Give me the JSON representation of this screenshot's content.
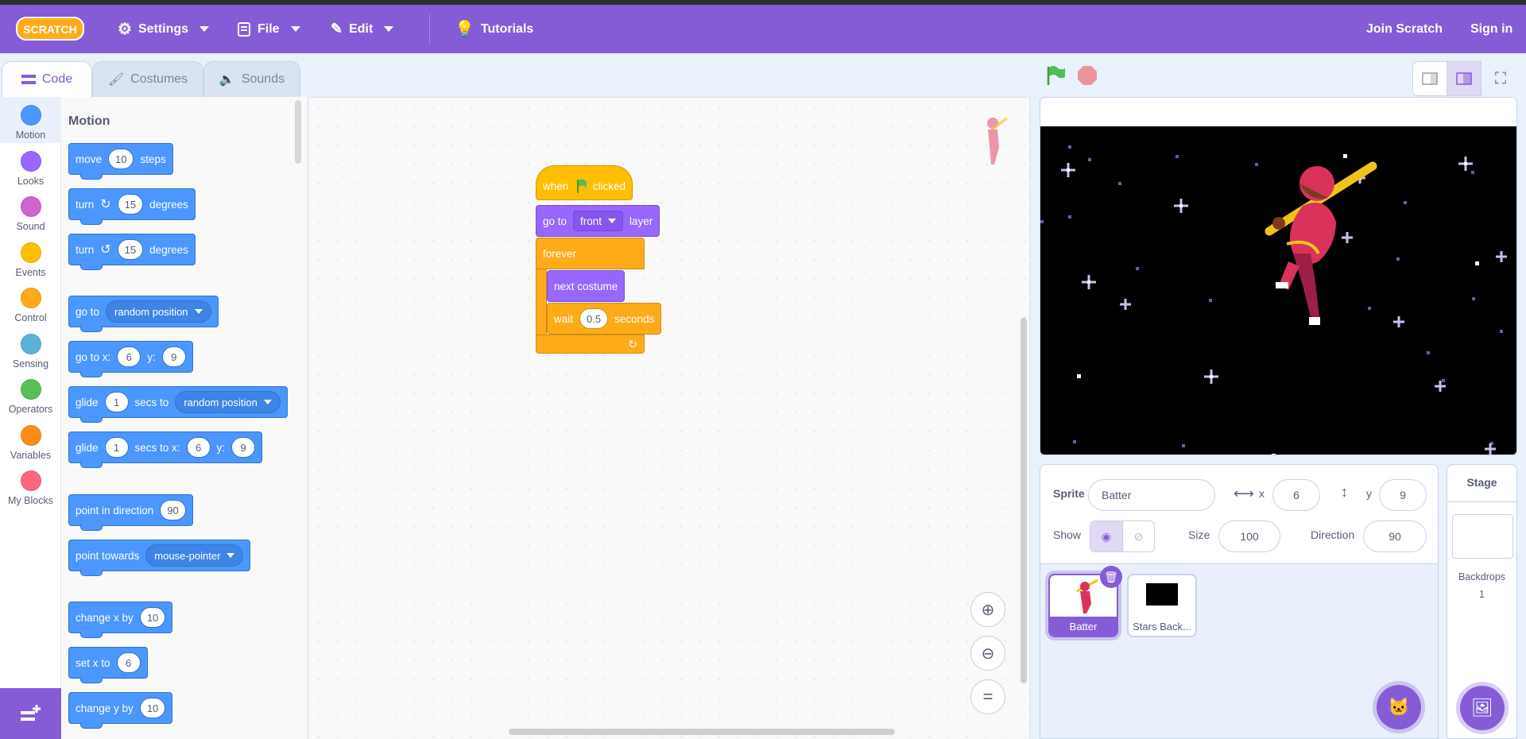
{
  "menubar": {
    "logo_text": "SCRATCH",
    "settings": "Settings",
    "file": "File",
    "edit": "Edit",
    "tutorials": "Tutorials",
    "join": "Join Scratch",
    "signin": "Sign in"
  },
  "tabs": {
    "code": "Code",
    "costumes": "Costumes",
    "sounds": "Sounds"
  },
  "categories": [
    "Motion",
    "Looks",
    "Sound",
    "Events",
    "Control",
    "Sensing",
    "Operators",
    "Variables",
    "My Blocks"
  ],
  "category_colors": [
    "#4c97ff",
    "#9966ff",
    "#cf63cf",
    "#ffbf00",
    "#ffab19",
    "#5cb1d6",
    "#59c059",
    "#ff8c1a",
    "#ff6680"
  ],
  "palette": {
    "title": "Motion",
    "move": {
      "a": "move",
      "n": "10",
      "b": "steps"
    },
    "turn_cw": {
      "a": "turn",
      "n": "15",
      "b": "degrees"
    },
    "turn_ccw": {
      "a": "turn",
      "n": "15",
      "b": "degrees"
    },
    "goto": {
      "a": "go to",
      "d": "random position"
    },
    "gotoxy": {
      "a": "go to x:",
      "x": "6",
      "ylab": "y:",
      "y": "9"
    },
    "glide1": {
      "a": "glide",
      "n": "1",
      "b": "secs to",
      "d": "random position"
    },
    "glide2": {
      "a": "glide",
      "n": "1",
      "b": "secs to x:",
      "x": "6",
      "ylab": "y:",
      "y": "9"
    },
    "point_dir": {
      "a": "point in direction",
      "n": "90"
    },
    "point_tow": {
      "a": "point towards",
      "d": "mouse-pointer"
    },
    "change_x": {
      "a": "change x by",
      "n": "10"
    },
    "set_x": {
      "a": "set x to",
      "n": "6"
    },
    "change_y": {
      "a": "change y by",
      "n": "10"
    }
  },
  "script": {
    "when": "when",
    "clicked": "clicked",
    "goto_a": "go to",
    "goto_d": "front",
    "goto_b": "layer",
    "forever": "forever",
    "next": "next costume",
    "wait_a": "wait",
    "wait_n": "0.5",
    "wait_b": "seconds"
  },
  "sprite": {
    "label": "Sprite",
    "name": "Batter",
    "x_label": "x",
    "x": "6",
    "y_label": "y",
    "y": "9",
    "show_label": "Show",
    "size_label": "Size",
    "size": "100",
    "direction_label": "Direction",
    "direction": "90"
  },
  "sprites": [
    {
      "name": "Batter"
    },
    {
      "name": "Stars Back..."
    }
  ],
  "stage_panel": {
    "title": "Stage",
    "backdrops_label": "Backdrops",
    "backdrops_count": "1"
  }
}
